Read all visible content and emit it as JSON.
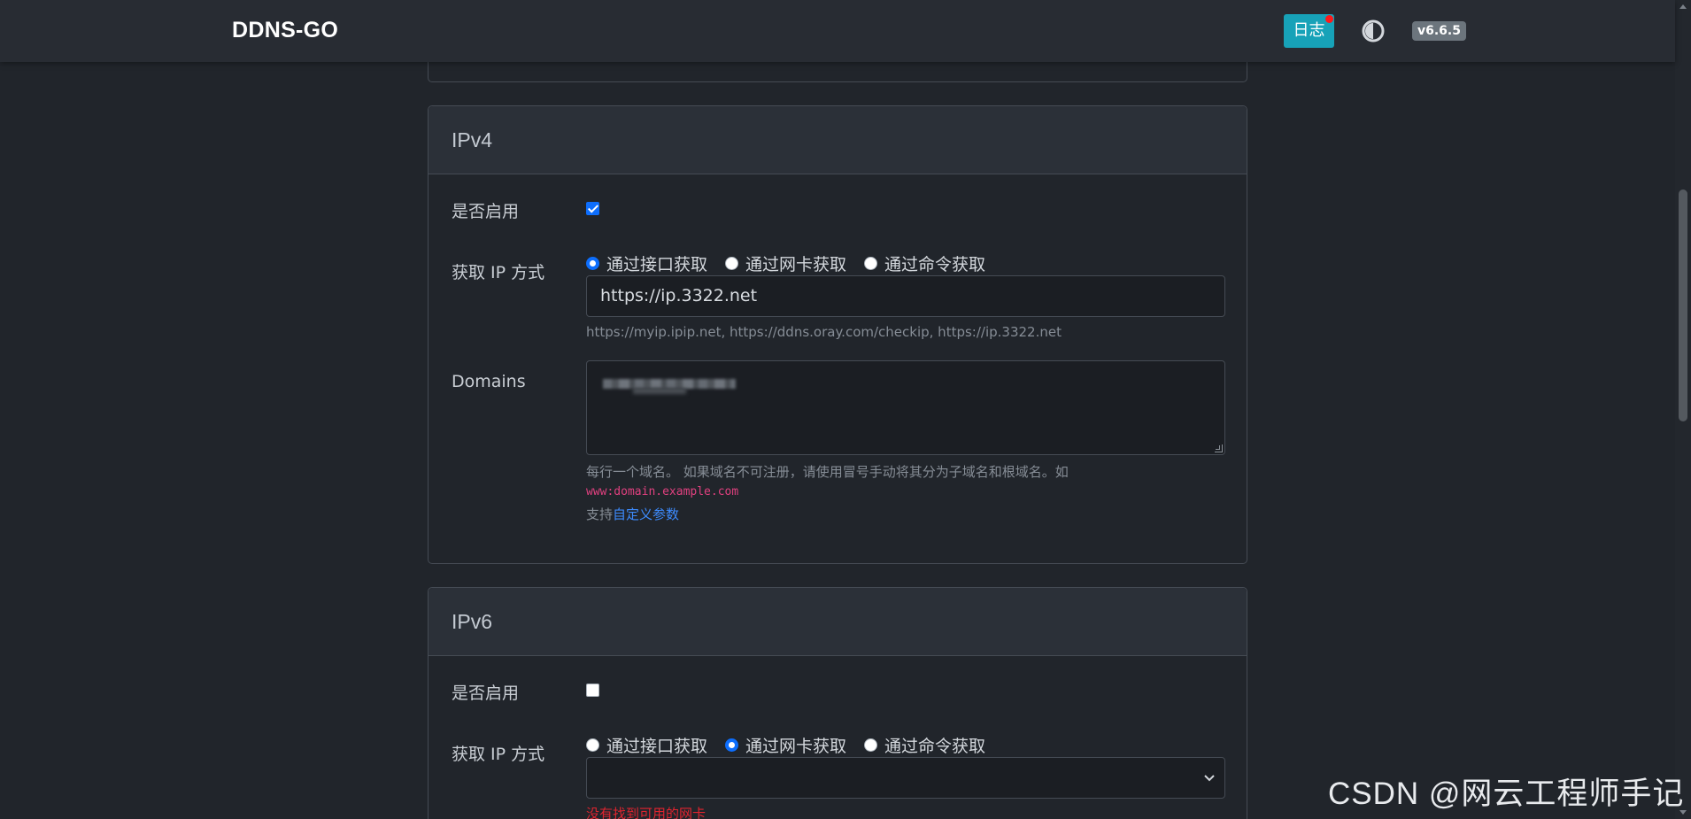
{
  "navbar": {
    "brand": "DDNS-GO",
    "log_button": "日志",
    "theme_icon": "half-circle-theme-icon",
    "version": "v6.6.5"
  },
  "ipv4": {
    "title": "IPv4",
    "enable_label": "是否启用",
    "enabled": true,
    "method_label": "获取 IP 方式",
    "methods": [
      "通过接口获取",
      "通过网卡获取",
      "通过命令获取"
    ],
    "selected_method": "通过接口获取",
    "url_value": "https://ip.3322.net",
    "url_help": "https://myip.ipip.net, https://ddns.oray.com/checkip, https://ip.3322.net",
    "domains_label": "Domains",
    "domains_help": "每行一个域名。 如果域名不可注册，请使用冒号手动将其分为子域名和根域名。如",
    "domains_example": "www:domain.example.com",
    "support_prefix": "支持",
    "support_link": "自定义参数"
  },
  "ipv6": {
    "title": "IPv6",
    "enable_label": "是否启用",
    "enabled": false,
    "method_label": "获取 IP 方式",
    "methods": [
      "通过接口获取",
      "通过网卡获取",
      "通过命令获取"
    ],
    "selected_method": "通过网卡获取",
    "select_value": "",
    "error": "没有找到可用的网卡"
  },
  "watermark": "CSDN @网云工程师手记",
  "colors": {
    "accent": "#0d6efd",
    "log_button": "#17a2b8",
    "error": "#e0242f",
    "code": "#e0407f",
    "background": "#21252b"
  }
}
